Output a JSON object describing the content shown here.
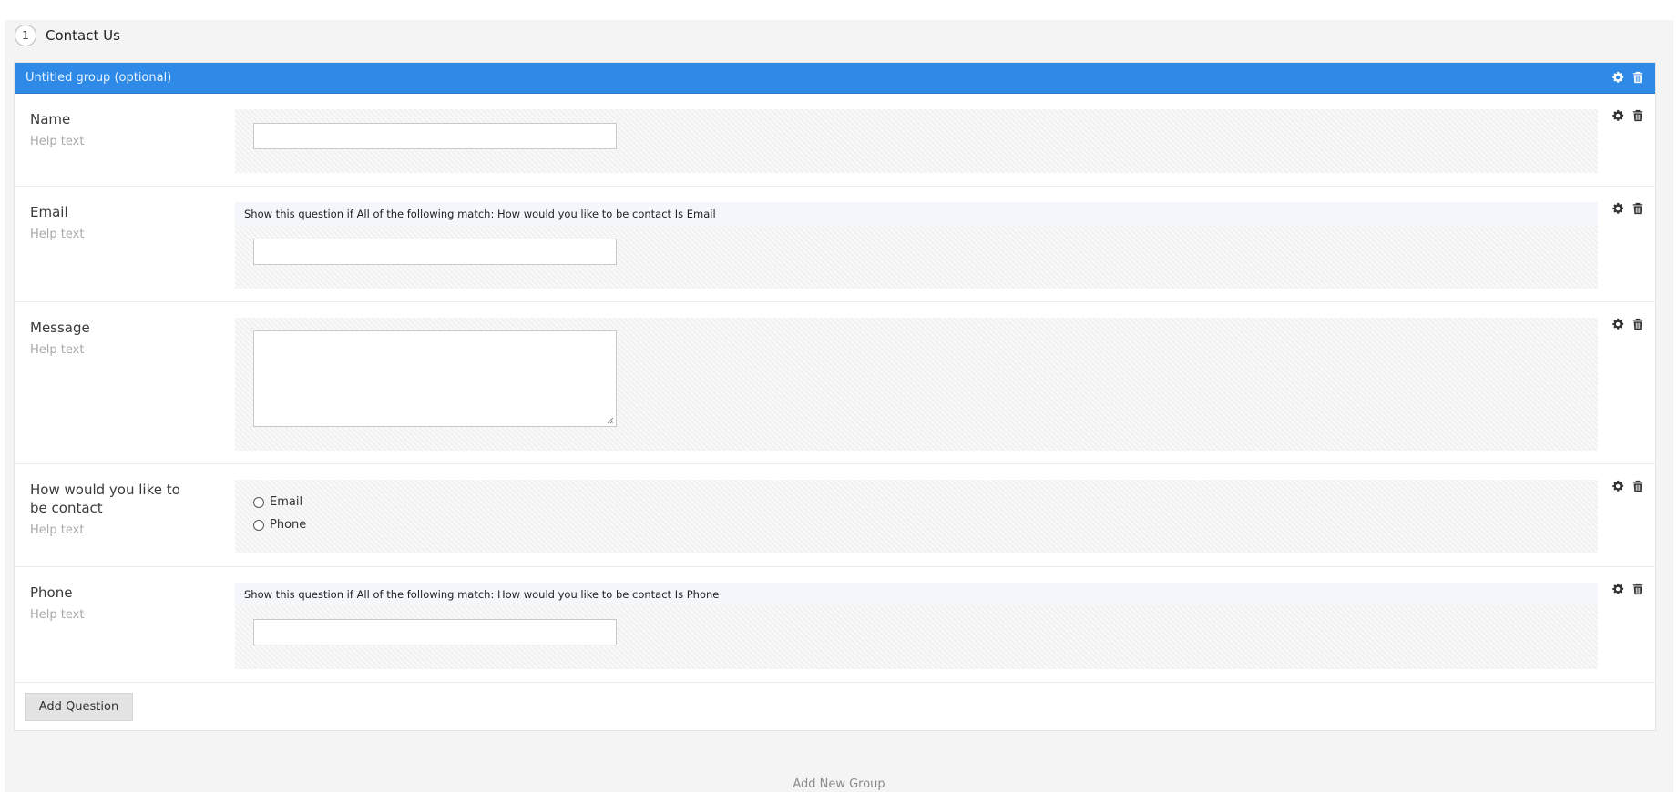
{
  "step": {
    "number": "1",
    "title": "Contact Us"
  },
  "group": {
    "title": "Untitled group (optional)"
  },
  "questions": [
    {
      "label": "Name",
      "help": "Help text",
      "type": "text",
      "condition": ""
    },
    {
      "label": "Email",
      "help": "Help text",
      "type": "text",
      "condition": "Show this question if All of the following match: How would you like to be contact Is Email"
    },
    {
      "label": "Message",
      "help": "Help text",
      "type": "textarea",
      "condition": ""
    },
    {
      "label": "How would you like to be contact",
      "help": "Help text",
      "type": "radio",
      "options": [
        "Email",
        "Phone"
      ],
      "condition": ""
    },
    {
      "label": "Phone",
      "help": "Help text",
      "type": "text",
      "condition": "Show this question if All of the following match: How would you like to be contact Is Phone"
    }
  ],
  "buttons": {
    "add_question": "Add Question",
    "add_group": "Add New Group"
  },
  "icons": {
    "settings": "gear-icon",
    "delete": "trash-icon"
  },
  "colors": {
    "group_bar": "#2e8ae6",
    "panel": "#f4f4f4"
  }
}
